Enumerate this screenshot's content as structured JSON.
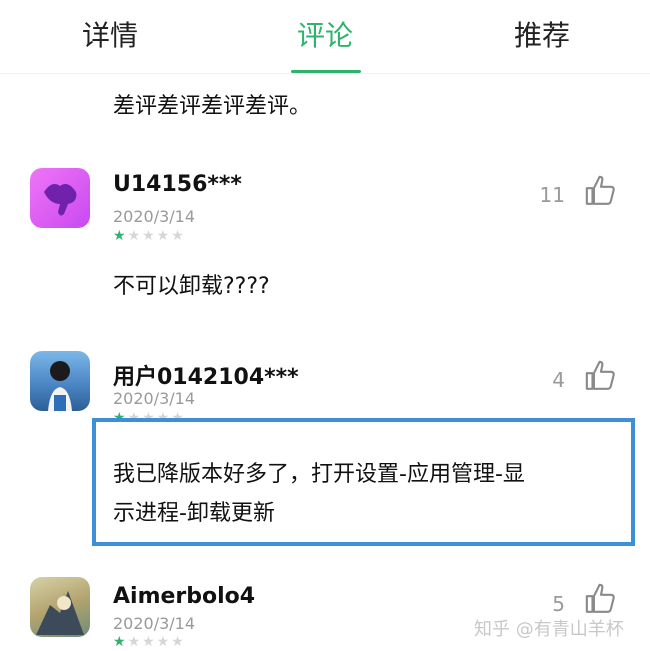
{
  "tabs": {
    "details": "详情",
    "comments": "评论",
    "recommend": "推荐"
  },
  "top_review_text": "差评差评差评差评。",
  "comments": [
    {
      "username": "U14156***",
      "date": "2020/3/14",
      "rating": 1,
      "text": "不可以卸载????",
      "likes": "11"
    },
    {
      "username": "用户0142104***",
      "date": "2020/3/14",
      "rating": 1,
      "text_line1": "我已降版本好多了，打开设置-应用管理-显",
      "text_line2": "示进程-卸载更新",
      "likes": "4"
    },
    {
      "username": "Aimerbolo4",
      "date": "2020/3/14",
      "rating": 1,
      "likes": "5"
    }
  ],
  "star_glyphs": {
    "filled": "★",
    "empty": "★★★★"
  },
  "watermark": "知乎 @有青山羊杯",
  "colors": {
    "accent": "#2db46c",
    "highlight_border": "#3d8fd8",
    "muted": "#9a9a9a"
  }
}
